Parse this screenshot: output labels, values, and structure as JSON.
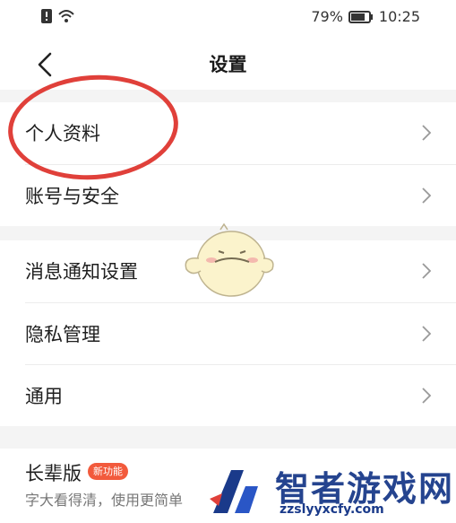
{
  "status_bar": {
    "battery": "79%",
    "time": "10:25",
    "icons": [
      "alert-icon",
      "wifi-icon",
      "battery-icon"
    ]
  },
  "nav": {
    "title": "设置",
    "back_icon": "chevron-left-icon"
  },
  "settings": {
    "items": [
      {
        "label": "个人资料"
      },
      {
        "label": "账号与安全"
      },
      {
        "label": "消息通知设置"
      },
      {
        "label": "隐私管理"
      },
      {
        "label": "通用"
      }
    ]
  },
  "elder": {
    "title": "长辈版",
    "badge": "新功能",
    "subtitle": "字大看得清，使用更简单"
  },
  "watermark": {
    "text": "智者游戏网",
    "url": "zzslyyxcfy.com"
  },
  "colors": {
    "annotation": "#e0403a",
    "badge": "#f25a3c",
    "watermark": "#1a3a8a"
  }
}
